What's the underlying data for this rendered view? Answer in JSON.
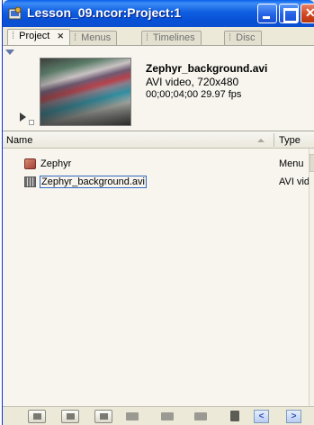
{
  "window": {
    "title": "Lesson_09.ncor:Project:1"
  },
  "tabs": [
    {
      "label": "Project",
      "active": true
    },
    {
      "label": "Menus",
      "active": false
    },
    {
      "label": "Timelines",
      "active": false
    },
    {
      "label": "Disc",
      "active": false
    }
  ],
  "preview": {
    "name": "Zephyr_background.avi",
    "type_line": "AVI video, 720x480",
    "duration_line": "00;00;04;00 29.97 fps"
  },
  "columns": {
    "name": "Name",
    "type": "Type"
  },
  "items": [
    {
      "name": "Zephyr",
      "type": "Menu",
      "icon": "menu-icon"
    },
    {
      "name": "Zephyr_background.avi",
      "type": "AVI vid",
      "icon": "video-file-icon"
    }
  ],
  "colors": {
    "titlebar": "#0851d6",
    "panel": "#ece9d8",
    "list_bg": "#f7f5ee",
    "selection_border": "#316ac5"
  }
}
